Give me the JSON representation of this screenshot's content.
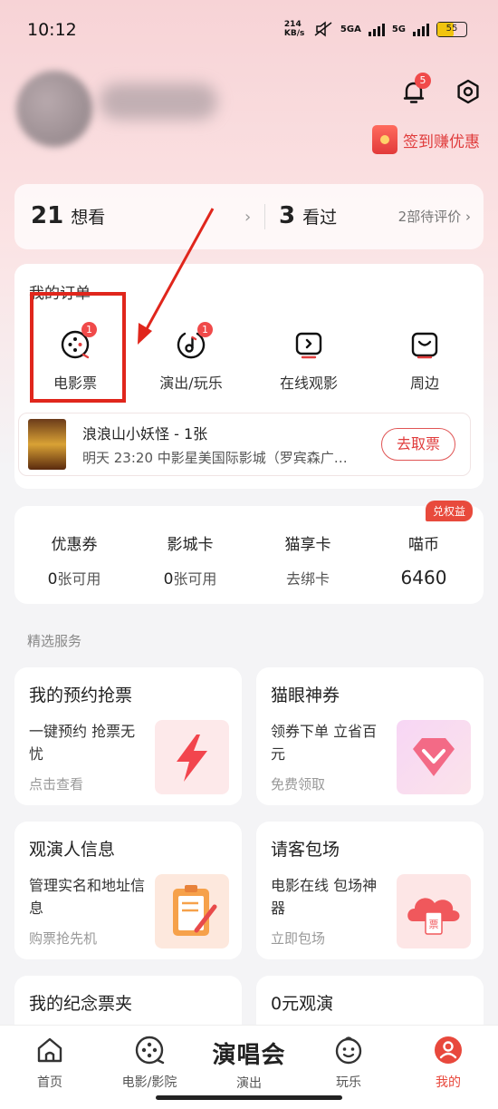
{
  "status_bar": {
    "time": "10:12",
    "speed": "214 KB/s",
    "net1": "5GA",
    "net2": "5G",
    "battery": "55"
  },
  "header": {
    "notification_count": "5",
    "checkin_label": "签到赚优惠"
  },
  "watch": {
    "want_count": "21",
    "want_label": "想看",
    "seen_count": "3",
    "seen_label": "看过",
    "pending_review": "2部待评价"
  },
  "orders": {
    "title": "我的订单",
    "items": [
      {
        "label": "电影票",
        "badge": "1",
        "icon": "film-reel-icon"
      },
      {
        "label": "演出/玩乐",
        "badge": "1",
        "icon": "music-note-icon"
      },
      {
        "label": "在线观影",
        "badge": "",
        "icon": "play-screen-icon"
      },
      {
        "label": "周边",
        "badge": "",
        "icon": "bag-icon"
      }
    ],
    "ticket": {
      "title": "浪浪山小妖怪 - 1张",
      "detail": "明天 23:20 中影星美国际影城（罗宾森广…",
      "action": "去取票"
    }
  },
  "wallet": {
    "items": [
      {
        "title": "优惠券",
        "count": "0",
        "unit": "张可用"
      },
      {
        "title": "影城卡",
        "count": "0",
        "unit": "张可用"
      },
      {
        "title": "猫享卡",
        "count": "",
        "unit": "去绑卡"
      },
      {
        "title": "喵币",
        "count": "6460",
        "unit": ""
      }
    ],
    "badge": "兑权益"
  },
  "services": {
    "title": "精选服务",
    "cards": [
      {
        "title": "我的预约抢票",
        "desc": "一键预约 抢票无忧",
        "sub": "点击查看",
        "icon": "lightning-icon"
      },
      {
        "title": "猫眼神券",
        "desc": "领券下单 立省百元",
        "sub": "免费领取",
        "icon": "diamond-icon"
      },
      {
        "title": "观演人信息",
        "desc": "管理实名和地址信息",
        "sub": "购票抢先机",
        "icon": "clipboard-icon"
      },
      {
        "title": "请客包场",
        "desc": "电影在线 包场神器",
        "sub": "立即包场",
        "icon": "cloud-ticket-icon"
      },
      {
        "title": "我的纪念票夹",
        "desc": "",
        "sub": "",
        "icon": ""
      },
      {
        "title": "0元观演",
        "desc": "",
        "sub": "",
        "icon": ""
      }
    ]
  },
  "bottom_nav": {
    "items": [
      {
        "label": "首页",
        "icon": "home-icon"
      },
      {
        "label": "电影/影院",
        "icon": "film-reel-icon"
      },
      {
        "label": "演出",
        "big": "演唱会"
      },
      {
        "label": "玩乐",
        "icon": "smile-icon"
      },
      {
        "label": "我的",
        "icon": "user-icon",
        "active": true
      }
    ],
    "active_color": "#e8483c"
  },
  "colors": {
    "accent": "#e03c3c",
    "badge": "#f04a4a"
  }
}
